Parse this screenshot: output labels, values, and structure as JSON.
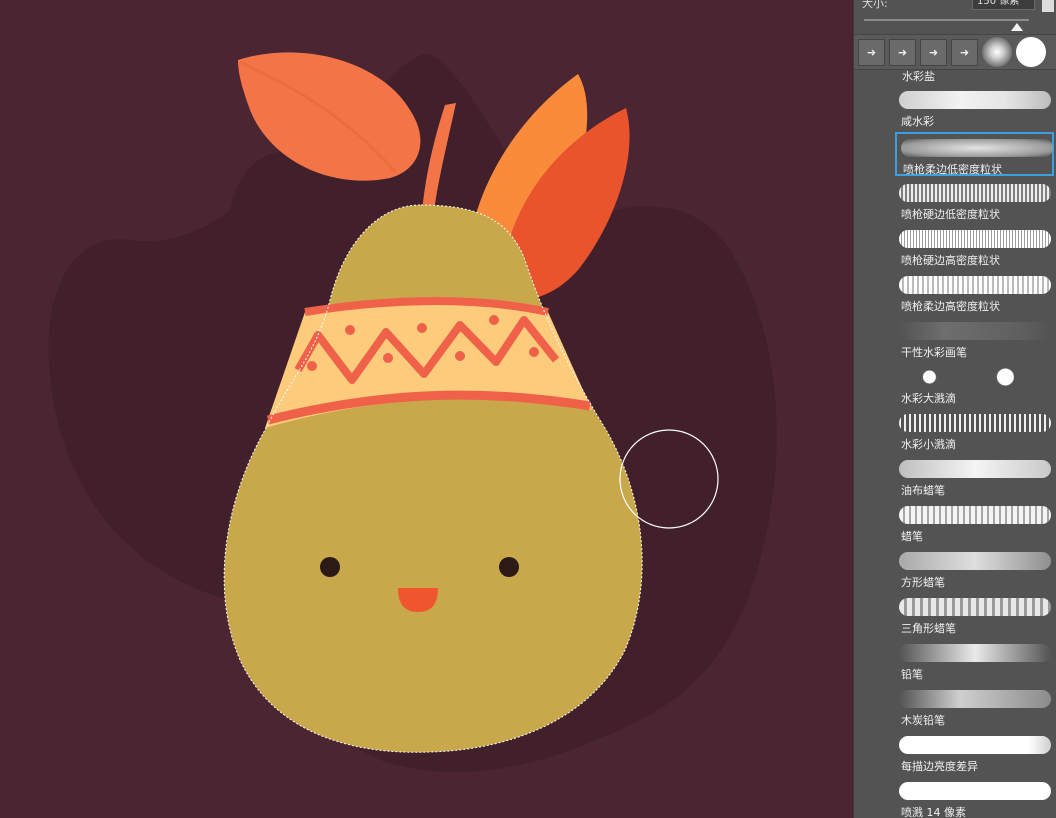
{
  "brush_panel": {
    "size_label": "大小:",
    "size_value": "150 像素",
    "tip_icons": [
      "brush-tip-icon",
      "brush-tip-icon",
      "brush-tip-icon",
      "brush-tip-icon",
      "soft-round-tip-icon",
      "hard-round-tip-icon"
    ],
    "top_label": "水彩盐",
    "brushes": [
      {
        "label": "咸水彩"
      },
      {
        "label": "喷枪柔边低密度粒状",
        "selected": true
      },
      {
        "label": "喷枪硬边低密度粒状"
      },
      {
        "label": "喷枪硬边高密度粒状"
      },
      {
        "label": "喷枪柔边高密度粒状"
      },
      {
        "label": "干性水彩画笔"
      },
      {
        "label": "水彩大溅滴"
      },
      {
        "label": "水彩小溅滴"
      },
      {
        "label": "油布蜡笔"
      },
      {
        "label": "蜡笔"
      },
      {
        "label": "方形蜡笔"
      },
      {
        "label": "三角形蜡笔"
      },
      {
        "label": "铅笔"
      },
      {
        "label": "木炭铅笔"
      },
      {
        "label": "每描边亮度差异"
      },
      {
        "label": "喷溅 14 像素"
      }
    ]
  },
  "colors": {
    "canvas_bg": "#4b2532",
    "shadow": "#41202b",
    "pear_body": "#c8a84b",
    "leaf": "#f37547",
    "feather_light": "#f98b3a",
    "feather_dark": "#e9542d",
    "band_bg": "#fccb7c",
    "band_pattern": "#f06149",
    "face": "#2b1a16",
    "mouth": "#f0562e",
    "selection": "#3aa0e0"
  }
}
